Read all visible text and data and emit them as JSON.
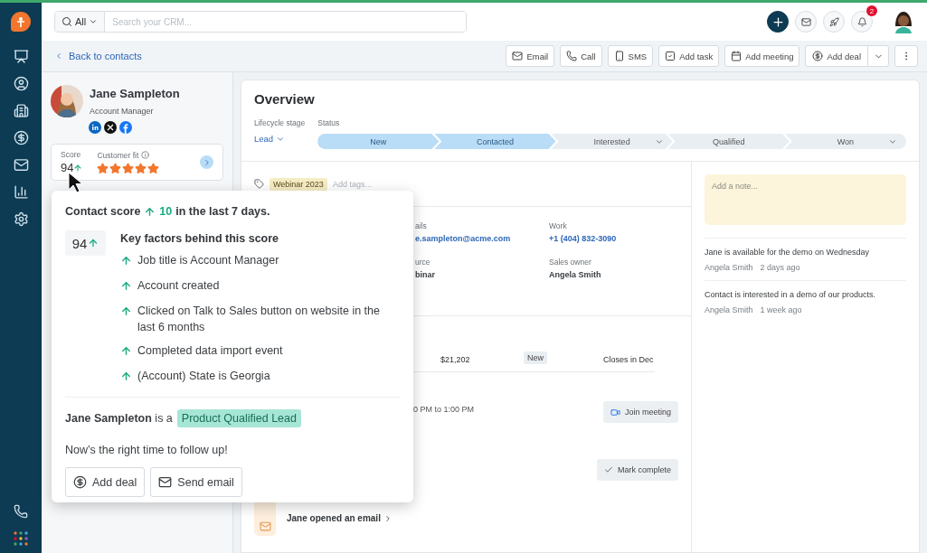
{
  "header": {
    "search_scope": "All",
    "search_placeholder": "Search your CRM...",
    "notifications": "2"
  },
  "back_link": "Back to contacts",
  "actions": [
    "Email",
    "Call",
    "SMS",
    "Add task",
    "Add meeting",
    "Add deal"
  ],
  "contact": {
    "name": "Jane Sampleton",
    "title": "Account Manager",
    "score_label": "Score",
    "score": "94",
    "fit_label": "Customer fit",
    "stars": 5
  },
  "overview": {
    "title": "Overview",
    "lifecycle_label": "Lifecycle stage",
    "lifecycle": "Lead",
    "status_label": "Status",
    "stages": [
      {
        "label": "New",
        "reached": true,
        "menu": false
      },
      {
        "label": "Contacted",
        "reached": true,
        "menu": false
      },
      {
        "label": "Interested",
        "reached": false,
        "menu": true
      },
      {
        "label": "Qualified",
        "reached": false,
        "menu": false
      },
      {
        "label": "Won",
        "reached": false,
        "menu": true
      }
    ]
  },
  "tags": {
    "items": [
      "Webinar 2023"
    ],
    "placeholder": "Add tags..."
  },
  "details": [
    {
      "label": "ails",
      "value": "e.sampleton@acme.com",
      "link": true
    },
    {
      "label": "Work",
      "value": "+1 (404) 832-3090",
      "link": true
    },
    {
      "label": "urce",
      "value": "binar",
      "link": false
    },
    {
      "label": "Sales owner",
      "value": "Angela Smith",
      "link": false
    }
  ],
  "deal": {
    "amount": "$21,202",
    "stage": "New",
    "closes": "Closes in Dec"
  },
  "meeting": {
    "time": "0 PM to 1:00 PM",
    "button": "Join meeting"
  },
  "task": {
    "button": "Mark complete"
  },
  "activity": {
    "title": "Jane opened an email"
  },
  "notes": {
    "placeholder": "Add a note...",
    "items": [
      {
        "text": "Jane is available for the demo on Wednesday",
        "author": "Angela Smith",
        "time": "2 days ago"
      },
      {
        "text": "Contact is interested in a demo of our products.",
        "author": "Angela Smith",
        "time": "1 week ago"
      }
    ]
  },
  "score_popover": {
    "lead": "Contact score",
    "delta": "10",
    "trail": "in the last 7 days.",
    "score": "94",
    "factors_title": "Key factors behind this score",
    "factors": [
      "Job title is Account Manager",
      "Account created",
      "Clicked on Talk to Sales button on website in the last 6 months",
      "Completed data import event",
      "(Account) State is Georgia"
    ],
    "summary": "**Jane Sampleton** is a",
    "badge": "Product Qualified Lead",
    "cta": "Now’s the right time to follow up!",
    "buttons": [
      "Add deal",
      "Send email"
    ]
  }
}
